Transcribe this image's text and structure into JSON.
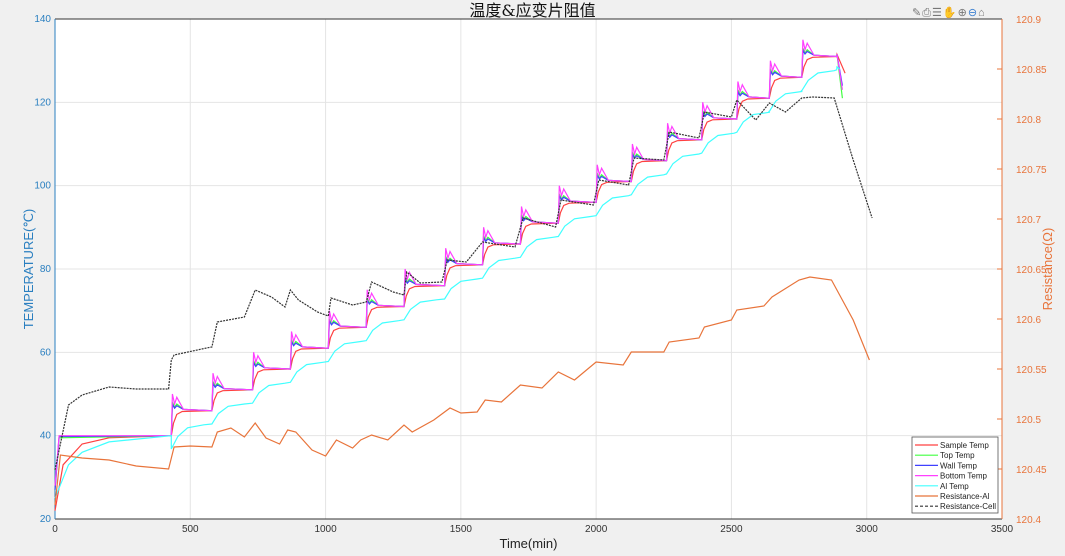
{
  "toolbar": {
    "icons": [
      "brush-icon",
      "print-icon",
      "legend-icon",
      "pan-icon",
      "zoom-in-icon",
      "zoom-out-icon",
      "home-icon"
    ]
  },
  "chart_data": {
    "type": "line",
    "title": "温度&应变片阻值",
    "xlabel": "Time(min)",
    "ylabel": "TEMPERATURE(℃)",
    "ylabel_right": "Resistance(Ω)",
    "xlim": [
      0,
      3500
    ],
    "ylim": [
      20,
      140
    ],
    "ylim_right": [
      120.4,
      120.9
    ],
    "xticks": [
      "0",
      "500",
      "1000",
      "1500",
      "2000",
      "2500",
      "3000",
      "3500"
    ],
    "yticks": [
      "20",
      "40",
      "60",
      "80",
      "100",
      "120",
      "140"
    ],
    "yticks_right": [
      "120.4",
      "120.45",
      "120.5",
      "120.55",
      "120.6",
      "120.65",
      "120.7",
      "120.75",
      "120.8",
      "120.85",
      "120.9"
    ],
    "grid": true,
    "legend_position": "bottom-right",
    "colors": {
      "left_axis": "#2a7fc0",
      "right_axis": "#e8743b"
    },
    "step_times": [
      430,
      580,
      730,
      870,
      1010,
      1150,
      1290,
      1440,
      1580,
      1720,
      1860,
      2000,
      2130,
      2260,
      2390,
      2520,
      2640,
      2760
    ],
    "step_levels": [
      46,
      51,
      56,
      61,
      66,
      71,
      76,
      81,
      86,
      91,
      96,
      101,
      106,
      111,
      116,
      121,
      126,
      131
    ],
    "series": [
      {
        "name": "Sample Temp",
        "color": "#ff4040",
        "axis": "left",
        "kind": "step",
        "overshoot": 0,
        "lag": 1,
        "offset": 0,
        "start": [
          [
            0,
            22
          ],
          [
            30,
            33
          ],
          [
            100,
            38
          ],
          [
            200,
            39.5
          ],
          [
            430,
            40
          ]
        ],
        "end": [
          [
            2890,
            131.5
          ],
          [
            2920,
            127
          ]
        ]
      },
      {
        "name": "Top Temp",
        "color": "#40ff40",
        "axis": "left",
        "kind": "step",
        "overshoot": 2,
        "lag": 0.6,
        "offset": 0,
        "start": [
          [
            0,
            27
          ],
          [
            15,
            39.5
          ],
          [
            430,
            40
          ]
        ],
        "end": [
          [
            2890,
            131.5
          ],
          [
            2910,
            121
          ]
        ]
      },
      {
        "name": "Wall Temp",
        "color": "#4040ff",
        "axis": "left",
        "kind": "step",
        "overshoot": 1.5,
        "lag": 0.5,
        "offset": 0,
        "start": [
          [
            0,
            27
          ],
          [
            15,
            39.8
          ],
          [
            430,
            40
          ]
        ],
        "end": [
          [
            2890,
            131.5
          ],
          [
            2910,
            124
          ]
        ]
      },
      {
        "name": "Bottom Temp",
        "color": "#ff40ff",
        "axis": "left",
        "kind": "step",
        "overshoot": 4,
        "lag": 0.3,
        "offset": 0,
        "start": [
          [
            0,
            28
          ],
          [
            15,
            40
          ],
          [
            430,
            40
          ]
        ],
        "end": [
          [
            2890,
            131.5
          ],
          [
            2910,
            123
          ]
        ]
      },
      {
        "name": "Al Temp",
        "color": "#40ffff",
        "axis": "left",
        "kind": "step",
        "overshoot": 0,
        "lag": 3,
        "offset": -3.2,
        "start": [
          [
            0,
            25
          ],
          [
            50,
            33
          ],
          [
            100,
            36
          ],
          [
            200,
            38.5
          ],
          [
            430,
            40
          ]
        ],
        "end": [
          [
            2890,
            128.5
          ],
          [
            2900,
            128
          ]
        ]
      },
      {
        "name": "Resistance-Al",
        "color": "#e8743b",
        "axis": "right",
        "dash": false,
        "points": [
          [
            0,
            120.414
          ],
          [
            20,
            120.464
          ],
          [
            100,
            120.461
          ],
          [
            200,
            120.459
          ],
          [
            300,
            120.453
          ],
          [
            420,
            120.45
          ],
          [
            440,
            120.472
          ],
          [
            500,
            120.473
          ],
          [
            580,
            120.472
          ],
          [
            600,
            120.487
          ],
          [
            650,
            120.491
          ],
          [
            700,
            120.482
          ],
          [
            740,
            120.496
          ],
          [
            780,
            120.481
          ],
          [
            830,
            120.475
          ],
          [
            860,
            120.489
          ],
          [
            890,
            120.487
          ],
          [
            950,
            120.469
          ],
          [
            1000,
            120.463
          ],
          [
            1040,
            120.479
          ],
          [
            1100,
            120.471
          ],
          [
            1130,
            120.479
          ],
          [
            1170,
            120.484
          ],
          [
            1230,
            120.479
          ],
          [
            1290,
            120.494
          ],
          [
            1320,
            120.487
          ],
          [
            1400,
            120.499
          ],
          [
            1460,
            120.511
          ],
          [
            1500,
            120.506
          ],
          [
            1560,
            120.507
          ],
          [
            1590,
            120.519
          ],
          [
            1650,
            120.517
          ],
          [
            1720,
            120.534
          ],
          [
            1800,
            120.531
          ],
          [
            1860,
            120.547
          ],
          [
            1920,
            120.539
          ],
          [
            2000,
            120.557
          ],
          [
            2100,
            120.554
          ],
          [
            2130,
            120.567
          ],
          [
            2250,
            120.567
          ],
          [
            2270,
            120.577
          ],
          [
            2380,
            120.581
          ],
          [
            2400,
            120.592
          ],
          [
            2500,
            120.599
          ],
          [
            2520,
            120.609
          ],
          [
            2620,
            120.613
          ],
          [
            2650,
            120.622
          ],
          [
            2750,
            120.639
          ],
          [
            2790,
            120.642
          ],
          [
            2870,
            120.639
          ],
          [
            2950,
            120.599
          ],
          [
            3010,
            120.559
          ]
        ]
      },
      {
        "name": "Resistance-Cell",
        "color": "#333333",
        "axis": "right",
        "dash": true,
        "points": [
          [
            0,
            120.449
          ],
          [
            50,
            120.514
          ],
          [
            100,
            120.524
          ],
          [
            200,
            120.532
          ],
          [
            300,
            120.53
          ],
          [
            420,
            120.53
          ],
          [
            430,
            120.559
          ],
          [
            440,
            120.564
          ],
          [
            560,
            120.571
          ],
          [
            580,
            120.572
          ],
          [
            600,
            120.597
          ],
          [
            700,
            120.602
          ],
          [
            740,
            120.629
          ],
          [
            800,
            120.622
          ],
          [
            850,
            120.612
          ],
          [
            870,
            120.629
          ],
          [
            900,
            120.619
          ],
          [
            970,
            120.607
          ],
          [
            1010,
            120.603
          ],
          [
            1020,
            120.621
          ],
          [
            1100,
            120.614
          ],
          [
            1150,
            120.617
          ],
          [
            1170,
            120.637
          ],
          [
            1250,
            120.627
          ],
          [
            1290,
            120.624
          ],
          [
            1300,
            120.647
          ],
          [
            1350,
            120.636
          ],
          [
            1430,
            120.637
          ],
          [
            1450,
            120.659
          ],
          [
            1520,
            120.657
          ],
          [
            1580,
            120.677
          ],
          [
            1700,
            120.672
          ],
          [
            1730,
            120.701
          ],
          [
            1850,
            120.692
          ],
          [
            1870,
            120.719
          ],
          [
            1990,
            120.714
          ],
          [
            2010,
            120.739
          ],
          [
            2120,
            120.734
          ],
          [
            2140,
            120.761
          ],
          [
            2250,
            120.759
          ],
          [
            2270,
            120.787
          ],
          [
            2380,
            120.781
          ],
          [
            2400,
            120.807
          ],
          [
            2500,
            120.802
          ],
          [
            2520,
            120.819
          ],
          [
            2590,
            120.799
          ],
          [
            2640,
            120.816
          ],
          [
            2700,
            120.807
          ],
          [
            2760,
            120.821
          ],
          [
            2800,
            120.822
          ],
          [
            2880,
            120.821
          ],
          [
            2950,
            120.759
          ],
          [
            3020,
            120.701
          ]
        ]
      }
    ]
  }
}
